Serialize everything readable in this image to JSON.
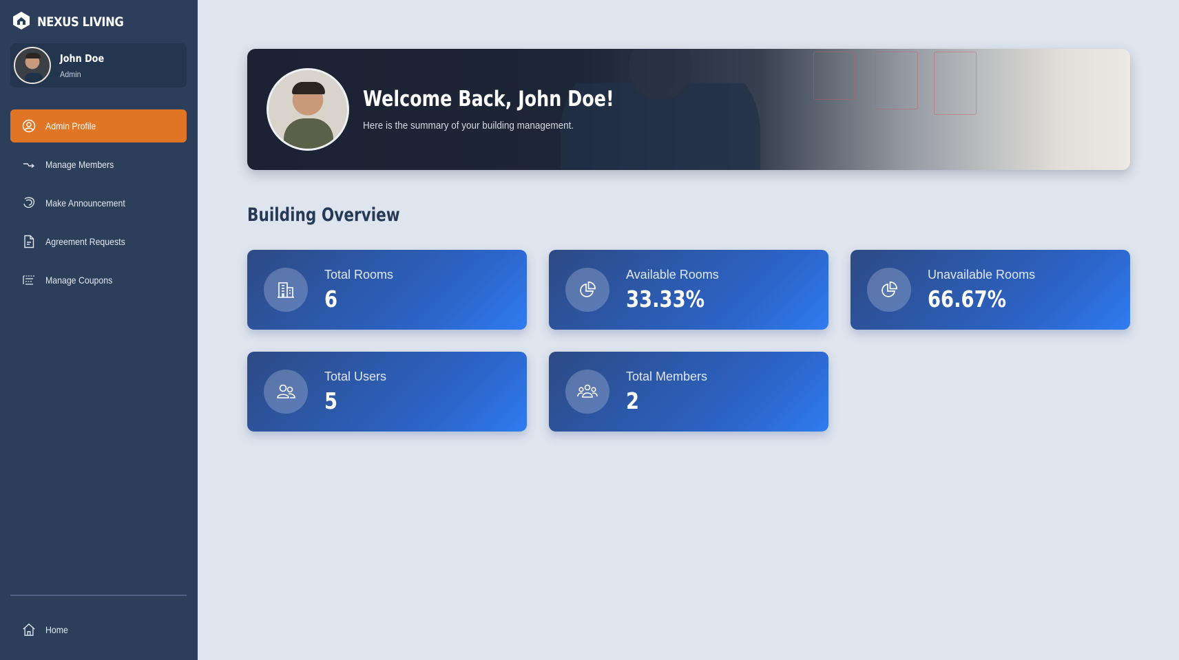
{
  "brand": {
    "name": "NEXUS LIVING",
    "icon": "house-hexagon-icon"
  },
  "user": {
    "name": "John Doe",
    "role": "Admin"
  },
  "sidebar": {
    "items": [
      {
        "label": "Admin Profile",
        "icon": "user-circle-icon",
        "active": true
      },
      {
        "label": "Manage Members",
        "icon": "arrow-member-icon",
        "active": false
      },
      {
        "label": "Make Announcement",
        "icon": "announcement-icon",
        "active": false
      },
      {
        "label": "Agreement Requests",
        "icon": "document-icon",
        "active": false
      },
      {
        "label": "Manage Coupons",
        "icon": "coupon-list-icon",
        "active": false
      }
    ],
    "home": {
      "label": "Home",
      "icon": "home-icon"
    }
  },
  "hero": {
    "title": "Welcome Back, John Doe!",
    "subtitle": "Here is the summary of your building management."
  },
  "overview": {
    "title": "Building Overview",
    "cards": [
      {
        "label": "Total Rooms",
        "value": "6",
        "icon": "building-icon"
      },
      {
        "label": "Available Rooms",
        "value": "33.33%",
        "icon": "pie-chart-icon"
      },
      {
        "label": "Unavailable Rooms",
        "value": "66.67%",
        "icon": "pie-chart-icon"
      },
      {
        "label": "Total Users",
        "value": "5",
        "icon": "users-icon"
      },
      {
        "label": "Total Members",
        "value": "2",
        "icon": "members-group-icon"
      }
    ]
  },
  "colors": {
    "sidebar": "#2c3e5a",
    "active": "#e07625",
    "background": "#dfe5ef",
    "card_start": "#2d4a84",
    "card_end": "#2f7cf2"
  }
}
